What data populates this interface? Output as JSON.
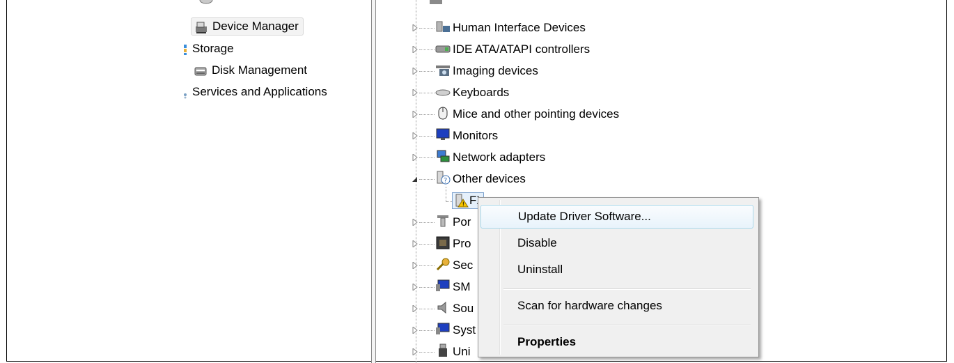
{
  "left_tree": {
    "device_manager": "Device Manager",
    "storage": "Storage",
    "disk_management": "Disk Management",
    "services": "Services and Applications"
  },
  "device_tree": {
    "rows": [
      {
        "label": "Human Interface Devices",
        "icon": "hid-icon"
      },
      {
        "label": "IDE ATA/ATAPI controllers",
        "icon": "ide-icon"
      },
      {
        "label": "Imaging devices",
        "icon": "camera-icon"
      },
      {
        "label": "Keyboards",
        "icon": "keyboard-icon"
      },
      {
        "label": "Mice and other pointing devices",
        "icon": "mouse-icon"
      },
      {
        "label": "Monitors",
        "icon": "monitor-icon"
      },
      {
        "label": "Network adapters",
        "icon": "network-icon"
      },
      {
        "label": "Other devices",
        "icon": "unknown-device-icon"
      },
      {
        "label": "FX3",
        "icon": "warning-device-icon"
      },
      {
        "label": "Por",
        "icon": "port-icon"
      },
      {
        "label": "Pro",
        "icon": "processor-icon"
      },
      {
        "label": "Sec",
        "icon": "key-icon"
      },
      {
        "label": "SM",
        "icon": "sm-icon"
      },
      {
        "label": "Sou",
        "icon": "speaker-icon"
      },
      {
        "label": "Syst",
        "icon": "system-icon"
      },
      {
        "label": "Uni",
        "icon": "usb-icon"
      }
    ]
  },
  "context_menu": {
    "update": "Update Driver Software...",
    "disable": "Disable",
    "uninstall": "Uninstall",
    "scan": "Scan for hardware changes",
    "properties": "Properties"
  },
  "colors": {
    "hover_border": "#a8d8eb",
    "menu_bg": "#f0f0f0"
  }
}
